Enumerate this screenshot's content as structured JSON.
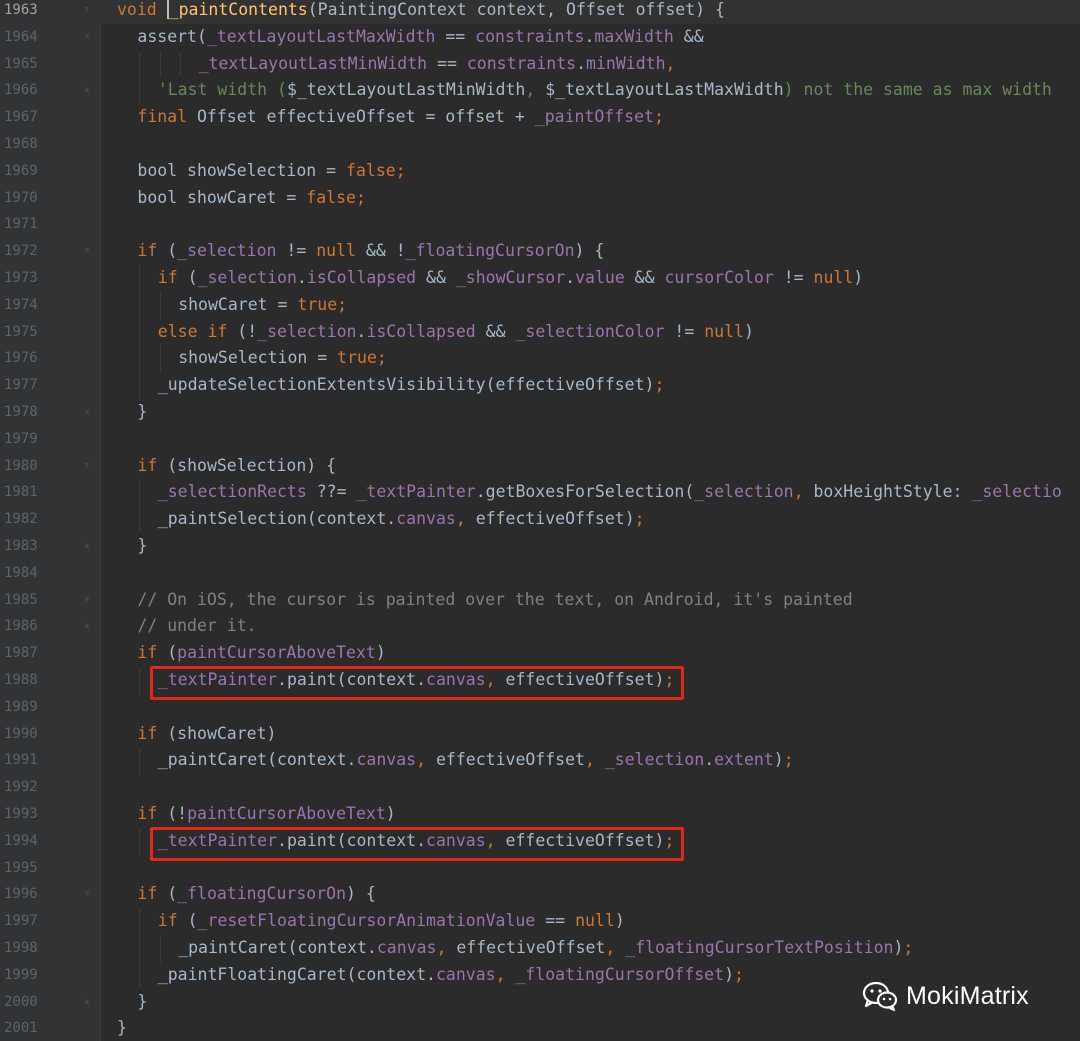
{
  "editor": {
    "colors": {
      "background": "#2b2b2b",
      "gutter": "#313335",
      "keyword": "#cc7832",
      "function": "#ffc66d",
      "field": "#9876aa",
      "string": "#6a8759",
      "comment": "#808080",
      "identifier": "#a9b7c6",
      "highlight_box": "#e1261c"
    },
    "current_line": 1963,
    "lines": [
      {
        "num": "1963",
        "indent": 0,
        "fold": "open",
        "tokens": [
          [
            "kw",
            "void "
          ],
          [
            "caret",
            ""
          ],
          [
            "fn",
            "_paintContents"
          ],
          [
            "id",
            "(PaintingContext context, Offset offset) {"
          ]
        ]
      },
      {
        "num": "1964",
        "indent": 1,
        "fold": "open",
        "tokens": [
          [
            "id",
            "assert("
          ],
          [
            "field",
            "_textLayoutLastMaxWidth"
          ],
          [
            "id",
            " == "
          ],
          [
            "field",
            "constraints"
          ],
          [
            "id",
            "."
          ],
          [
            "field",
            "maxWidth"
          ],
          [
            "id",
            " &&"
          ]
        ]
      },
      {
        "num": "1965",
        "indent": 4,
        "fold": "",
        "tokens": [
          [
            "field",
            "_textLayoutLastMinWidth"
          ],
          [
            "id",
            " == "
          ],
          [
            "field",
            "constraints"
          ],
          [
            "id",
            "."
          ],
          [
            "field",
            "minWidth"
          ],
          [
            "kw",
            ","
          ]
        ]
      },
      {
        "num": "1966",
        "indent": 2,
        "fold": "close",
        "tokens": [
          [
            "str",
            "'Last width ("
          ],
          [
            "id",
            "$_textLayoutLastMinWidth"
          ],
          [
            "str",
            ", "
          ],
          [
            "id",
            "$_textLayoutLastMaxWidth"
          ],
          [
            "str",
            ") not the same as max width"
          ]
        ]
      },
      {
        "num": "1967",
        "indent": 1,
        "fold": "",
        "tokens": [
          [
            "kw",
            "final "
          ],
          [
            "id",
            "Offset effectiveOffset = offset + "
          ],
          [
            "field",
            "_paintOffset"
          ],
          [
            "kw",
            ";"
          ]
        ]
      },
      {
        "num": "1968",
        "indent": 0,
        "fold": "",
        "tokens": []
      },
      {
        "num": "1969",
        "indent": 1,
        "fold": "",
        "tokens": [
          [
            "id",
            "bool showSelection = "
          ],
          [
            "kw",
            "false;"
          ]
        ]
      },
      {
        "num": "1970",
        "indent": 1,
        "fold": "",
        "tokens": [
          [
            "id",
            "bool showCaret = "
          ],
          [
            "kw",
            "false;"
          ]
        ]
      },
      {
        "num": "1971",
        "indent": 0,
        "fold": "",
        "tokens": []
      },
      {
        "num": "1972",
        "indent": 1,
        "fold": "open",
        "tokens": [
          [
            "kw",
            "if "
          ],
          [
            "id",
            "("
          ],
          [
            "field",
            "_selection"
          ],
          [
            "id",
            " != "
          ],
          [
            "kw",
            "null"
          ],
          [
            "id",
            " && !"
          ],
          [
            "field",
            "_floatingCursorOn"
          ],
          [
            "id",
            ") {"
          ]
        ]
      },
      {
        "num": "1973",
        "indent": 2,
        "fold": "",
        "tokens": [
          [
            "kw",
            "if "
          ],
          [
            "id",
            "("
          ],
          [
            "field",
            "_selection"
          ],
          [
            "id",
            "."
          ],
          [
            "field",
            "isCollapsed"
          ],
          [
            "id",
            " && "
          ],
          [
            "field",
            "_showCursor"
          ],
          [
            "id",
            "."
          ],
          [
            "field",
            "value"
          ],
          [
            "id",
            " && "
          ],
          [
            "field",
            "cursorColor"
          ],
          [
            "id",
            " != "
          ],
          [
            "kw",
            "null"
          ],
          [
            "id",
            ")"
          ]
        ]
      },
      {
        "num": "1974",
        "indent": 3,
        "fold": "",
        "tokens": [
          [
            "id",
            "showCaret = "
          ],
          [
            "kw",
            "true;"
          ]
        ]
      },
      {
        "num": "1975",
        "indent": 2,
        "fold": "",
        "tokens": [
          [
            "kw",
            "else if "
          ],
          [
            "id",
            "(!"
          ],
          [
            "field",
            "_selection"
          ],
          [
            "id",
            "."
          ],
          [
            "field",
            "isCollapsed"
          ],
          [
            "id",
            " && "
          ],
          [
            "field",
            "_selectionColor"
          ],
          [
            "id",
            " != "
          ],
          [
            "kw",
            "null"
          ],
          [
            "id",
            ")"
          ]
        ]
      },
      {
        "num": "1976",
        "indent": 3,
        "fold": "",
        "tokens": [
          [
            "id",
            "showSelection = "
          ],
          [
            "kw",
            "true;"
          ]
        ]
      },
      {
        "num": "1977",
        "indent": 2,
        "fold": "",
        "tokens": [
          [
            "id",
            "_updateSelectionExtentsVisibility(effectiveOffset)"
          ],
          [
            "kw",
            ";"
          ]
        ]
      },
      {
        "num": "1978",
        "indent": 1,
        "fold": "close",
        "tokens": [
          [
            "id",
            "}"
          ]
        ]
      },
      {
        "num": "1979",
        "indent": 0,
        "fold": "",
        "tokens": []
      },
      {
        "num": "1980",
        "indent": 1,
        "fold": "open",
        "tokens": [
          [
            "kw",
            "if "
          ],
          [
            "id",
            "(showSelection) {"
          ]
        ]
      },
      {
        "num": "1981",
        "indent": 2,
        "fold": "",
        "tokens": [
          [
            "field",
            "_selectionRects"
          ],
          [
            "id",
            " ??= "
          ],
          [
            "field",
            "_textPainter"
          ],
          [
            "id",
            ".getBoxesForSelection("
          ],
          [
            "field",
            "_selection"
          ],
          [
            "kw",
            ", "
          ],
          [
            "id",
            "boxHeightStyle: "
          ],
          [
            "field",
            "_selectio"
          ]
        ]
      },
      {
        "num": "1982",
        "indent": 2,
        "fold": "",
        "tokens": [
          [
            "id",
            "_paintSelection(context."
          ],
          [
            "field",
            "canvas"
          ],
          [
            "kw",
            ", "
          ],
          [
            "id",
            "effectiveOffset)"
          ],
          [
            "kw",
            ";"
          ]
        ]
      },
      {
        "num": "1983",
        "indent": 1,
        "fold": "close",
        "tokens": [
          [
            "id",
            "}"
          ]
        ]
      },
      {
        "num": "1984",
        "indent": 0,
        "fold": "",
        "tokens": []
      },
      {
        "num": "1985",
        "indent": 1,
        "fold": "open",
        "tokens": [
          [
            "cmt",
            "// On iOS, the cursor is painted over the text, on Android, it's painted"
          ]
        ]
      },
      {
        "num": "1986",
        "indent": 1,
        "fold": "close",
        "tokens": [
          [
            "cmt",
            "// under it."
          ]
        ]
      },
      {
        "num": "1987",
        "indent": 1,
        "fold": "",
        "tokens": [
          [
            "kw",
            "if "
          ],
          [
            "id",
            "("
          ],
          [
            "field",
            "paintCursorAboveText"
          ],
          [
            "id",
            ")"
          ]
        ]
      },
      {
        "num": "1988",
        "indent": 2,
        "fold": "",
        "tokens": [
          [
            "field",
            "_textPainter"
          ],
          [
            "id",
            ".paint(context."
          ],
          [
            "field",
            "canvas"
          ],
          [
            "kw",
            ", "
          ],
          [
            "id",
            "effectiveOffset)"
          ],
          [
            "kw",
            ";"
          ]
        ]
      },
      {
        "num": "1989",
        "indent": 0,
        "fold": "",
        "tokens": []
      },
      {
        "num": "1990",
        "indent": 1,
        "fold": "",
        "tokens": [
          [
            "kw",
            "if "
          ],
          [
            "id",
            "(showCaret)"
          ]
        ]
      },
      {
        "num": "1991",
        "indent": 2,
        "fold": "",
        "tokens": [
          [
            "id",
            "_paintCaret(context."
          ],
          [
            "field",
            "canvas"
          ],
          [
            "kw",
            ", "
          ],
          [
            "id",
            "effectiveOffset"
          ],
          [
            "kw",
            ", "
          ],
          [
            "field",
            "_selection"
          ],
          [
            "id",
            "."
          ],
          [
            "field",
            "extent"
          ],
          [
            "id",
            ")"
          ],
          [
            "kw",
            ";"
          ]
        ]
      },
      {
        "num": "1992",
        "indent": 0,
        "fold": "",
        "tokens": []
      },
      {
        "num": "1993",
        "indent": 1,
        "fold": "",
        "tokens": [
          [
            "kw",
            "if "
          ],
          [
            "id",
            "(!"
          ],
          [
            "field",
            "paintCursorAboveText"
          ],
          [
            "id",
            ")"
          ]
        ]
      },
      {
        "num": "1994",
        "indent": 2,
        "fold": "",
        "tokens": [
          [
            "field",
            "_textPainter"
          ],
          [
            "id",
            ".paint(context."
          ],
          [
            "field",
            "canvas"
          ],
          [
            "kw",
            ", "
          ],
          [
            "id",
            "effectiveOffset)"
          ],
          [
            "kw",
            ";"
          ]
        ]
      },
      {
        "num": "1995",
        "indent": 0,
        "fold": "",
        "tokens": []
      },
      {
        "num": "1996",
        "indent": 1,
        "fold": "open",
        "tokens": [
          [
            "kw",
            "if "
          ],
          [
            "id",
            "("
          ],
          [
            "field",
            "_floatingCursorOn"
          ],
          [
            "id",
            ") {"
          ]
        ]
      },
      {
        "num": "1997",
        "indent": 2,
        "fold": "",
        "tokens": [
          [
            "kw",
            "if "
          ],
          [
            "id",
            "("
          ],
          [
            "field",
            "_resetFloatingCursorAnimationValue"
          ],
          [
            "id",
            " == "
          ],
          [
            "kw",
            "null"
          ],
          [
            "id",
            ")"
          ]
        ]
      },
      {
        "num": "1998",
        "indent": 3,
        "fold": "",
        "tokens": [
          [
            "id",
            "_paintCaret(context."
          ],
          [
            "field",
            "canvas"
          ],
          [
            "kw",
            ", "
          ],
          [
            "id",
            "effectiveOffset"
          ],
          [
            "kw",
            ", "
          ],
          [
            "field",
            "_floatingCursorTextPosition"
          ],
          [
            "id",
            ")"
          ],
          [
            "kw",
            ";"
          ]
        ]
      },
      {
        "num": "1999",
        "indent": 2,
        "fold": "",
        "tokens": [
          [
            "id",
            "_paintFloatingCaret(context."
          ],
          [
            "field",
            "canvas"
          ],
          [
            "kw",
            ", "
          ],
          [
            "field",
            "_floatingCursorOffset"
          ],
          [
            "id",
            ")"
          ],
          [
            "kw",
            ";"
          ]
        ]
      },
      {
        "num": "2000",
        "indent": 1,
        "fold": "close",
        "tokens": [
          [
            "id",
            "}"
          ]
        ]
      },
      {
        "num": "2001",
        "indent": 0,
        "fold": "",
        "tokens": [
          [
            "id",
            "}"
          ]
        ]
      }
    ],
    "highlighted_lines": [
      "1988",
      "1994"
    ]
  },
  "watermark": {
    "icon": "wechat-icon",
    "text": "MokiMatrix"
  }
}
